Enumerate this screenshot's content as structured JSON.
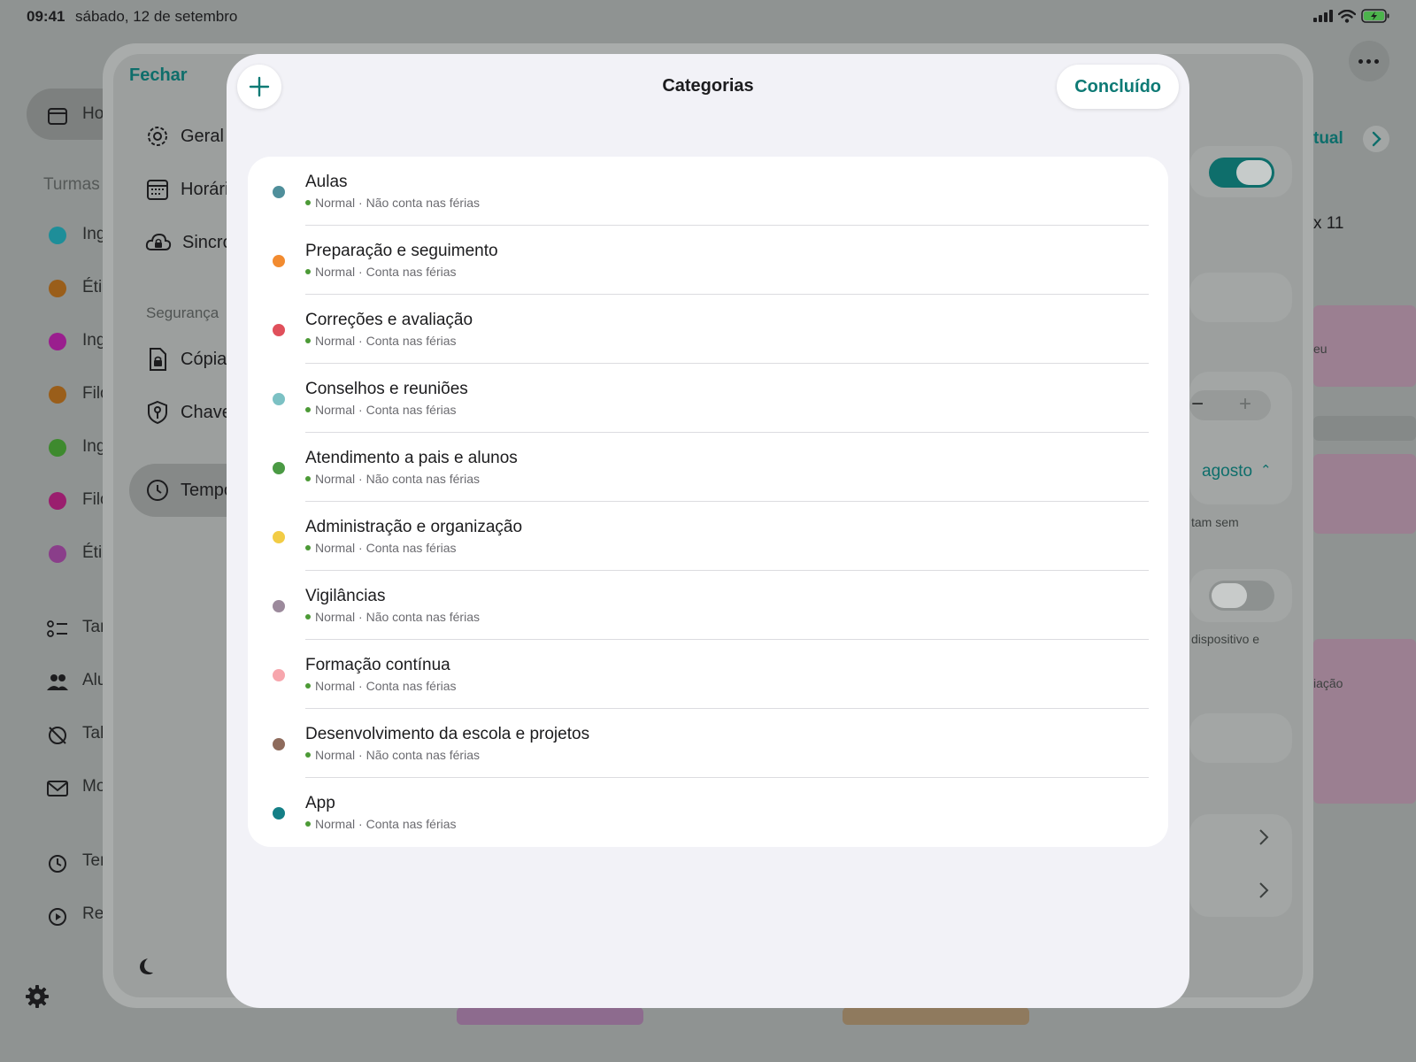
{
  "status_bar": {
    "time": "09:41",
    "date": "sábado, 12 de setembro"
  },
  "background_app": {
    "home_label": "Ho",
    "turmas_label": "Turmas",
    "classes": [
      {
        "label": "Ing",
        "color": "#1e8e99"
      },
      {
        "label": "Éti",
        "color": "#9a5e1a"
      },
      {
        "label": "Ing",
        "color": "#9a1e8e"
      },
      {
        "label": "Filo",
        "color": "#9a5e1a"
      },
      {
        "label": "Ing",
        "color": "#3e8a2e"
      },
      {
        "label": "Filo",
        "color": "#9a1e6e"
      },
      {
        "label": "Éti",
        "color": "#8a3e8a"
      }
    ],
    "nav_items": [
      {
        "label": "Tar",
        "icon": "checklist-icon"
      },
      {
        "label": "Alu",
        "icon": "people-icon"
      },
      {
        "label": "Tal",
        "icon": "no-clock-icon"
      },
      {
        "label": "Mo",
        "icon": "mail-icon"
      },
      {
        "label": "Ter",
        "icon": "clock-icon"
      },
      {
        "label": "Re",
        "icon": "play-icon"
      }
    ]
  },
  "settings": {
    "close_label": "Fechar",
    "items": [
      {
        "label": "Geral",
        "icon": "gear-icon"
      },
      {
        "label": "Horári",
        "icon": "calendar-icon"
      },
      {
        "label": "Sincro",
        "icon": "cloud-lock-icon"
      }
    ],
    "section_label": "Segurança",
    "security_items": [
      {
        "label": "Cópia",
        "icon": "document-lock-icon"
      },
      {
        "label": "Chave",
        "icon": "shield-key-icon"
      }
    ],
    "selected_item": {
      "label": "Tempo",
      "icon": "clock-icon"
    },
    "right_fragments": {
      "nav_label": "tual",
      "count_label": "x 11",
      "event_1": "eu",
      "month_select": "agosto",
      "note_1": "tam sem",
      "note_2": "dispositivo e",
      "event_2": "iação"
    }
  },
  "modal": {
    "title": "Categorias",
    "done_label": "Concluído",
    "categories": [
      {
        "name": "Aulas",
        "type": "Normal",
        "holidays": "Não conta nas férias",
        "color": "#4f8f9b"
      },
      {
        "name": "Preparação e seguimento",
        "type": "Normal",
        "holidays": "Conta nas férias",
        "color": "#f28b30"
      },
      {
        "name": "Correções e avaliação",
        "type": "Normal",
        "holidays": "Conta nas férias",
        "color": "#e0505b"
      },
      {
        "name": "Conselhos e reuniões",
        "type": "Normal",
        "holidays": "Conta nas férias",
        "color": "#7cc1c4"
      },
      {
        "name": "Atendimento a pais e alunos",
        "type": "Normal",
        "holidays": "Não conta nas férias",
        "color": "#4a9a44"
      },
      {
        "name": "Administração e organização",
        "type": "Normal",
        "holidays": "Conta nas férias",
        "color": "#f2cc45"
      },
      {
        "name": "Vigilâncias",
        "type": "Normal",
        "holidays": "Não conta nas férias",
        "color": "#9c8a9c"
      },
      {
        "name": "Formação contínua",
        "type": "Normal",
        "holidays": "Conta nas férias",
        "color": "#f7a6ad"
      },
      {
        "name": "Desenvolvimento da escola e projetos",
        "type": "Normal",
        "holidays": "Não conta nas férias",
        "color": "#8e6b5c"
      },
      {
        "name": "App",
        "type": "Normal",
        "holidays": "Conta nas férias",
        "color": "#147f86"
      }
    ]
  },
  "colors": {
    "accent": "#0e7a75",
    "status_dot": "#4c9a36"
  }
}
